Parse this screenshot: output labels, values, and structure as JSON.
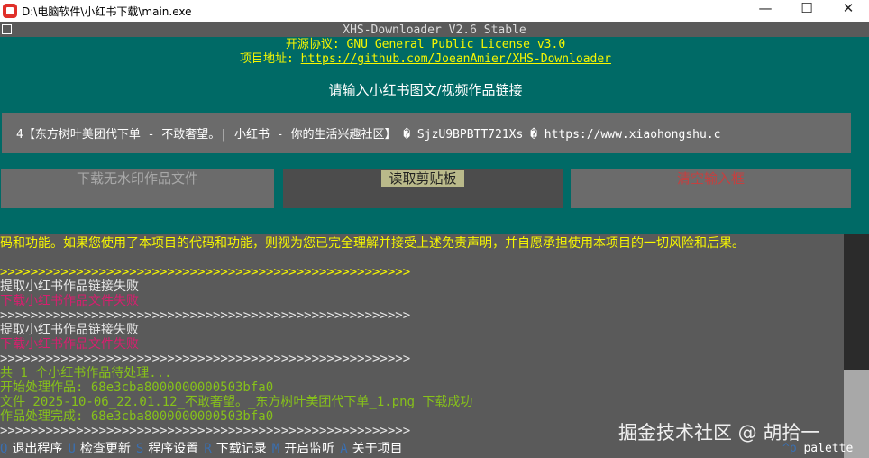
{
  "window": {
    "title": "D:\\电脑软件\\小红书下载\\main.exe",
    "minimize_glyph": "—",
    "maximize_glyph": "☐",
    "close_glyph": "✕"
  },
  "header": {
    "app_title": "XHS-Downloader V2.6 Stable",
    "license": "开源协议: GNU General Public License v3.0",
    "repo_label": "项目地址: ",
    "repo_url": "https://github.com/JoeanAmier/XHS-Downloader"
  },
  "input": {
    "prompt": "请输入小红书图文/视频作品链接",
    "value": "4【东方树叶美团代下单 - 不敢奢望。| 小红书 - 你的生活兴趣社区】 � SjzU9BPBTT721Xs � https://www.xiaohongshu.c"
  },
  "buttons": {
    "download": "下载无水印作品文件",
    "paste": "读取剪贴板",
    "clear": "清空输入框"
  },
  "log": [
    {
      "text": "码和功能。如果您使用了本项目的代码和功能，则视为您已完全理解并接受上述免责声明，并自愿承担使用本项目的一切风险和后果。",
      "color": "yellow"
    },
    {
      "text": "",
      "color": "white"
    },
    {
      "text": ">>>>>>>>>>>>>>>>>>>>>>>>>>>>>>>>>>>>>>>>>>>>>>>>>>>>>>",
      "color": "yellow"
    },
    {
      "text": "提取小红书作品链接失败",
      "color": "white"
    },
    {
      "text": "下载小红书作品文件失败",
      "color": "pink"
    },
    {
      "text": ">>>>>>>>>>>>>>>>>>>>>>>>>>>>>>>>>>>>>>>>>>>>>>>>>>>>>>",
      "color": "white"
    },
    {
      "text": "提取小红书作品链接失败",
      "color": "white"
    },
    {
      "text": "下载小红书作品文件失败",
      "color": "pink"
    },
    {
      "text": ">>>>>>>>>>>>>>>>>>>>>>>>>>>>>>>>>>>>>>>>>>>>>>>>>>>>>>",
      "color": "white"
    },
    {
      "text": "共 1 个小红书作品待处理...",
      "color": "green"
    },
    {
      "text": "开始处理作品: 68e3cba8000000000503bfa0",
      "color": "green"
    },
    {
      "text": "文件 2025-10-06_22.01.12_不敢奢望。_东方树叶美团代下单_1.png 下载成功",
      "color": "green"
    },
    {
      "text": "作品处理完成: 68e3cba8000000000503bfa0",
      "color": "green"
    },
    {
      "text": ">>>>>>>>>>>>>>>>>>>>>>>>>>>>>>>>>>>>>>>>>>>>>>>>>>>>>>",
      "color": "white"
    }
  ],
  "footer": {
    "items": [
      {
        "key": "Q",
        "label": "退出程序"
      },
      {
        "key": "U",
        "label": "检查更新"
      },
      {
        "key": "S",
        "label": "程序设置"
      },
      {
        "key": "R",
        "label": "下载记录"
      },
      {
        "key": "M",
        "label": "开启监听"
      },
      {
        "key": "A",
        "label": "关于项目"
      }
    ],
    "palette_key": "^p",
    "palette_label": "palette"
  },
  "watermark": "掘金技术社区 @ 胡拾一",
  "colors": {
    "teal": "#006a66",
    "log_yellow": "#f7f700",
    "log_pink": "#d71f6f",
    "log_green": "#86c11a",
    "key_blue": "#3a6fb0"
  }
}
